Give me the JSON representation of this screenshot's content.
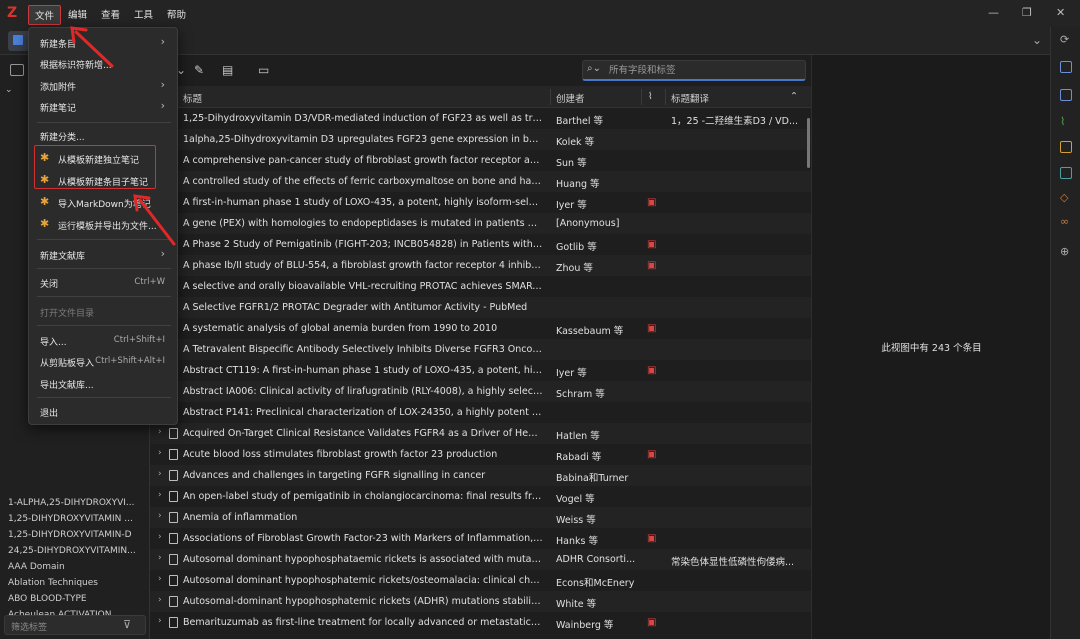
{
  "app": {
    "logo": "Z"
  },
  "menubar": {
    "file": "文件",
    "edit": "编辑",
    "view": "查看",
    "tools": "工具",
    "help": "帮助"
  },
  "window": {
    "minimize": "—",
    "maximize": "❐",
    "close": "✕"
  },
  "search": {
    "placeholder": "所有字段和标签"
  },
  "table": {
    "headers": {
      "title": "标题",
      "creator": "创建者",
      "translation": "标题翻译"
    },
    "rows": [
      {
        "title": "1,25-Dihydroxyvitamin D3/VDR-mediated induction of FGF23 as well as tra...",
        "creator": "Barthel 等",
        "att": "",
        "trans": "1，25 -二羟维生素D3 / VD...",
        "twisty": ""
      },
      {
        "title": "1alpha,25-Dihydroxyvitamin D3 upregulates FGF23 gene expression in bon...",
        "creator": "Kolek 等",
        "att": "",
        "trans": "",
        "twisty": ""
      },
      {
        "title": "A comprehensive pan-cancer study of fibroblast growth factor receptor abe...",
        "creator": "Sun 等",
        "att": "",
        "trans": "",
        "twisty": ""
      },
      {
        "title": "A controlled study of the effects of ferric carboxymaltose on bone and hae...",
        "creator": "Huang 等",
        "att": "",
        "trans": "",
        "twisty": ""
      },
      {
        "title": "A first-in-human phase 1 study of LOXO-435, a potent, highly isoform-selec...",
        "creator": "Iyer 等",
        "att": "▣",
        "trans": "",
        "twisty": ""
      },
      {
        "title": "A gene (PEX) with homologies to endopeptidases is mutated in patients wit...",
        "creator": "[Anonymous]",
        "att": "",
        "trans": "",
        "twisty": ""
      },
      {
        "title": "A Phase 2 Study of Pemigatinib (FIGHT-203; INCB054828) in Patients with ...",
        "creator": "Gotlib 等",
        "att": "▣",
        "trans": "",
        "twisty": ""
      },
      {
        "title": "A phase Ib/II study of BLU-554, a fibroblast growth factor receptor 4 inhibit...",
        "creator": "Zhou 等",
        "att": "▣",
        "trans": "",
        "twisty": ""
      },
      {
        "title": "A selective and orally bioavailable VHL-recruiting PROTAC achieves SMARC...",
        "creator": "",
        "att": "",
        "trans": "",
        "twisty": ""
      },
      {
        "title": "A Selective FGFR1/2 PROTAC Degrader with Antitumor Activity - PubMed",
        "creator": "",
        "att": "",
        "trans": "",
        "twisty": ""
      },
      {
        "title": "A systematic analysis of global anemia burden from 1990 to 2010",
        "creator": "Kassebaum 等",
        "att": "▣",
        "trans": "",
        "twisty": ""
      },
      {
        "title": "A Tetravalent Bispecific Antibody Selectively Inhibits Diverse FGFR3 Oncoge...",
        "creator": "",
        "att": "",
        "trans": "",
        "twisty": ""
      },
      {
        "title": "Abstract CT119: A first-in-human phase 1 study of LOXO-435, a potent, hig...",
        "creator": "Iyer 等",
        "att": "▣",
        "trans": "",
        "twisty": ""
      },
      {
        "title": "Abstract IA006: Clinical activity of lirafugratinib (RLY-4008), a highly selectiv...",
        "creator": "Schram 等",
        "att": "",
        "trans": "",
        "twisty": ""
      },
      {
        "title": "Abstract P141: Preclinical characterization of LOX-24350, a highly potent an...",
        "creator": "",
        "att": "",
        "trans": "",
        "twisty": ""
      },
      {
        "title": "Acquired On-Target Clinical Resistance Validates FGFR4 as a Driver of Hepat...",
        "creator": "Hatlen 等",
        "att": "",
        "trans": "",
        "twisty": "›"
      },
      {
        "title": "Acute blood loss stimulates fibroblast growth factor 23 production",
        "creator": "Rabadi 等",
        "att": "▣",
        "trans": "",
        "twisty": "›"
      },
      {
        "title": "Advances and challenges in targeting FGFR signalling in cancer",
        "creator": "Babina和Turner",
        "att": "",
        "trans": "",
        "twisty": "›"
      },
      {
        "title": "An open-label study of pemigatinib in cholangiocarcinoma: final results fro...",
        "creator": "Vogel 等",
        "att": "",
        "trans": "",
        "twisty": "›"
      },
      {
        "title": "Anemia of inflammation",
        "creator": "Weiss 等",
        "att": "",
        "trans": "",
        "twisty": "›"
      },
      {
        "title": "Associations of Fibroblast Growth Factor-23 with Markers of Inflammation, I...",
        "creator": "Hanks 等",
        "att": "▣",
        "trans": "",
        "twisty": "›"
      },
      {
        "title": "Autosomal dominant hypophosphataemic rickets is associated with mutati...",
        "creator": "ADHR Consorti...",
        "att": "",
        "trans": "常染色体显性低磷性佝偻病...",
        "twisty": "›"
      },
      {
        "title": "Autosomal dominant hypophosphatemic rickets/osteomalacia: clinical char...",
        "creator": "Econs和McEnery",
        "att": "",
        "trans": "",
        "twisty": "›"
      },
      {
        "title": "Autosomal-dominant hypophosphatemic rickets (ADHR) mutations stabiliz...",
        "creator": "White 等",
        "att": "",
        "trans": "",
        "twisty": "›"
      },
      {
        "title": "Bemarituzumab as first-line treatment for locally advanced or metastatic ga...",
        "creator": "Wainberg 等",
        "att": "▣",
        "trans": "",
        "twisty": "›"
      }
    ]
  },
  "rightpane": {
    "count_text": "此视图中有 243 个条目"
  },
  "tags": {
    "items": [
      "1-ALPHA,25-DIHYDROXYVI...",
      "1,25-DIHYDROXYVITAMIN ...",
      "1,25-DIHYDROXYVITAMIN-D",
      "24,25-DIHYDROXYVITAMIN...",
      "AAA Domain",
      "Ablation Techniques",
      "ABO BLOOD-TYPE",
      "Acheulean ACTIVATION"
    ],
    "filter_placeholder": "筛选标签"
  },
  "file_menu": {
    "new_item": "新建条目",
    "new_by_id": "根据标识符新增...",
    "add_attachment": "添加附件",
    "new_note": "新建笔记",
    "new_collection": "新建分类...",
    "new_standalone_from_template": "从模板新建独立笔记",
    "new_child_from_template": "从模板新建条目子笔记",
    "import_markdown": "导入MarkDown为笔记",
    "run_template_export": "运行模板并导出为文件...",
    "new_library": "新建文献库",
    "close": "关闭",
    "close_shortcut": "Ctrl+W",
    "open_directory": "打开文件目录",
    "import": "导入...",
    "import_shortcut": "Ctrl+Shift+I",
    "import_clipboard": "从剪贴板导入",
    "import_clipboard_shortcut": "Ctrl+Shift+Alt+I",
    "export_library": "导出文献库...",
    "quit": "退出"
  },
  "colors": {
    "accent": "#4a78c8",
    "highlight": "#d03030",
    "plugin_icon": "#e9a33b"
  }
}
